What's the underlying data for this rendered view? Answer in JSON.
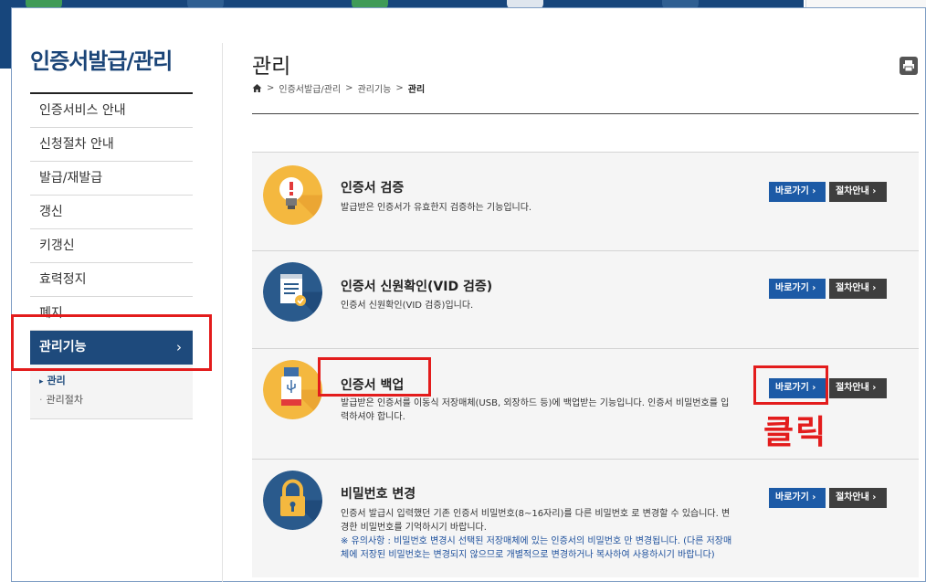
{
  "sidebar": {
    "title": "인증서발급/관리",
    "items": [
      {
        "label": "인증서비스 안내"
      },
      {
        "label": "신청절차 안내"
      },
      {
        "label": "발급/재발급"
      },
      {
        "label": "갱신"
      },
      {
        "label": "키갱신"
      },
      {
        "label": "효력정지"
      },
      {
        "label": "폐지"
      },
      {
        "label": "관리기능",
        "chevron": "›"
      }
    ],
    "submenu": [
      {
        "label": "관리"
      },
      {
        "label": "관리절차"
      }
    ]
  },
  "page": {
    "title": "관리",
    "breadcrumb": [
      "인증서발급/관리",
      "관리기능",
      "관리"
    ],
    "separator": ">"
  },
  "cards": [
    {
      "title": "인증서 검증",
      "desc": "발급받은 인증서가 유효한지 검증하는 기능입니다.",
      "icon": "lightbulb-icon",
      "go_label": "바로가기 ›",
      "guide_label": "절차안내 ›"
    },
    {
      "title": "인증서 신원확인(VID 검증)",
      "desc": "인증서 신원확인(VID 검증)입니다.",
      "icon": "document-check-icon",
      "go_label": "바로가기 ›",
      "guide_label": "절차안내 ›"
    },
    {
      "title": "인증서 백업",
      "desc": "발급받은 인증서를 이동식 저장매체(USB, 외장하드 등)에 백업받는 기능입니다. 인증서 비밀번호를 입력하셔야 합니다.",
      "icon": "usb-drive-icon",
      "go_label": "바로가기 ›",
      "guide_label": "절차안내 ›"
    },
    {
      "title": "비밀번호 변경",
      "desc": "인증서 발급시 입력했던 기존 인증서 비밀번호(8~16자리)를 다른 비밀번호 로 변경할 수 있습니다. 변경한 비밀번호를 기억하시기 바랍니다.",
      "note": "※ 유의사항 : 비밀번호 변경시 선택된 저장매체에 있는 인증서의 비밀번호 만 변경됩니다. (다른 저장매체에 저장된 비밀번호는 변경되지 않으므로 개별적으로 변경하거나 복사하여 사용하시기 바랍니다)",
      "icon": "padlock-icon",
      "go_label": "바로가기 ›",
      "guide_label": "절차안내 ›"
    }
  ],
  "annotation": {
    "label": "클릭",
    "color": "#e31c1c"
  },
  "colors": {
    "brand": "#1e4a7c",
    "go_button": "#1c5aa6",
    "guide_button": "#3e3e3e",
    "note_text": "#1c4f9c"
  }
}
